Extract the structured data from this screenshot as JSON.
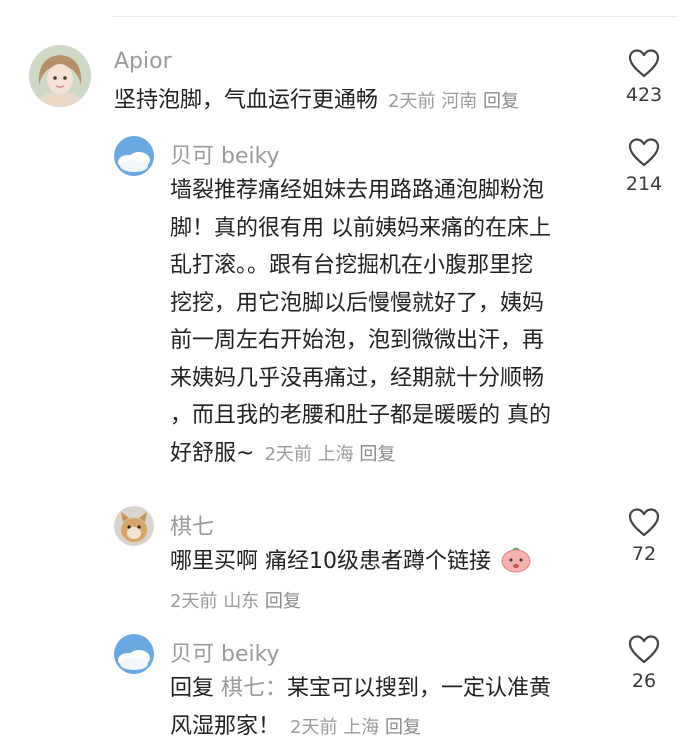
{
  "comments": [
    {
      "user": "Apior",
      "text": "坚持泡脚，气血运行更通畅",
      "time": "2天前",
      "location": "河南",
      "reply": "回复",
      "likes": "423"
    },
    {
      "user": "贝可 beiky",
      "lines": [
        "墙裂推荐痛经姐妹去用路路通泡脚粉泡",
        "脚！真的很有用 以前姨妈来痛的在床上",
        "乱打滚。。跟有台挖掘机在小腹那里挖",
        "挖挖，用它泡脚以后慢慢就好了，姨妈",
        "前一周左右开始泡，泡到微微出汗，再",
        "来姨妈几乎没再痛过，经期就十分顺畅",
        "，而且我的老腰和肚子都是暖暖的 真的",
        "好舒服~"
      ],
      "time": "2天前",
      "location": "上海",
      "reply": "回复",
      "likes": "214"
    },
    {
      "user": "棋七",
      "text": "哪里买啊 痛经10级患者蹲个链接",
      "time": "2天前",
      "location": "山东",
      "reply": "回复",
      "likes": "72"
    },
    {
      "user": "贝可 beiky",
      "reply_prefix": "回复",
      "reply_to": "棋七：",
      "line1": "某宝可以搜到，一定认准黄",
      "line2": "风湿那家！",
      "time": "2天前",
      "location": "上海",
      "reply": "回复",
      "likes": "26"
    }
  ],
  "colors": {
    "text": "#222222",
    "meta": "#9b9b9b",
    "username": "#9a9a9a"
  }
}
